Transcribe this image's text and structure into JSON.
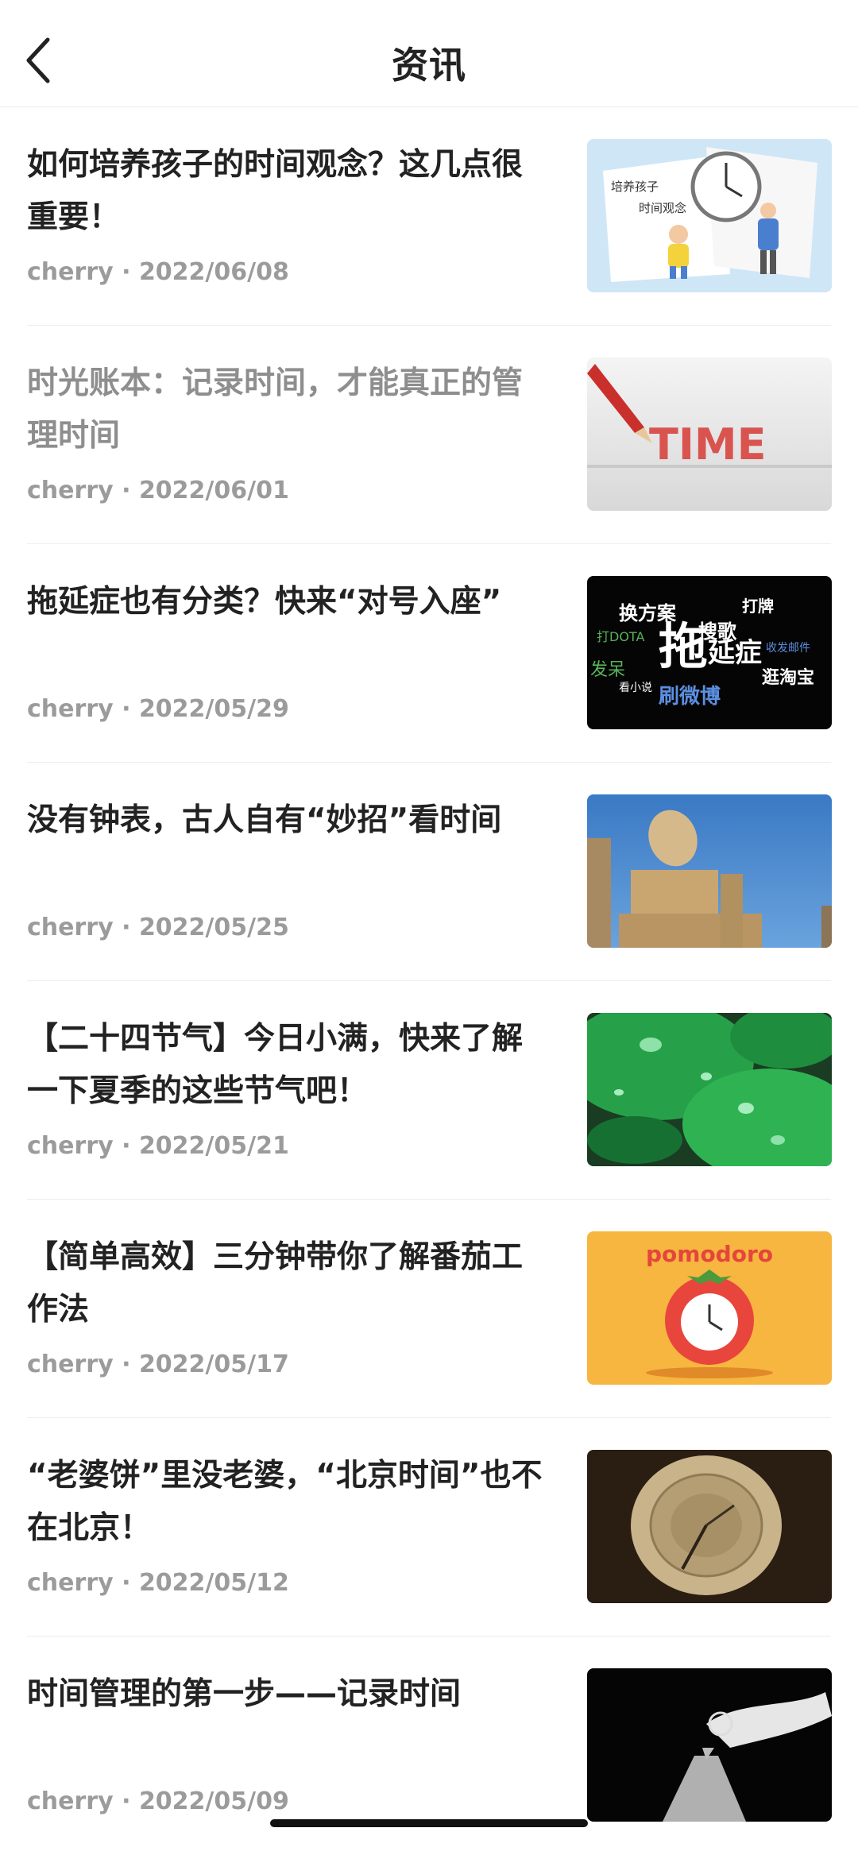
{
  "header": {
    "title": "资讯"
  },
  "items": [
    {
      "title": "如何培养孩子的时间观念？这几点很重要！",
      "author": "cherry",
      "date": "2022/06/08",
      "read": false,
      "thumb": {
        "caption_1": "培养孩子",
        "caption_2": "时间观念"
      }
    },
    {
      "title": "时光账本：记录时间，才能真正的管理时间",
      "author": "cherry",
      "date": "2022/06/01",
      "read": true,
      "thumb": {
        "word": "TIME"
      }
    },
    {
      "title": "拖延症也有分类？快来“对号入座”",
      "author": "cherry",
      "date": "2022/05/29",
      "read": false,
      "thumb": {
        "main_1": "拖",
        "main_2": "延症",
        "words": [
          "换方案",
          "搜歌",
          "打DOTA",
          "发呆",
          "刷微博",
          "逛淘宝",
          "打牌",
          "看小说",
          "收发邮件"
        ]
      }
    },
    {
      "title": "没有钟表，古人自有“妙招”看时间",
      "author": "cherry",
      "date": "2022/05/25",
      "read": false
    },
    {
      "title": "【二十四节气】今日小满，快来了解一下夏季的这些节气吧！",
      "author": "cherry",
      "date": "2022/05/21",
      "read": false
    },
    {
      "title": "【简单高效】三分钟带你了解番茄工作法",
      "author": "cherry",
      "date": "2022/05/17",
      "read": false,
      "thumb": {
        "word": "pomodoro"
      }
    },
    {
      "title": "“老婆饼”里没老婆，“北京时间”也不在北京！",
      "author": "cherry",
      "date": "2022/05/12",
      "read": false
    },
    {
      "title": "时间管理的第一步——记录时间",
      "author": "cherry",
      "date": "2022/05/09",
      "read": false
    }
  ],
  "meta_separator": " · ",
  "icons": {
    "back": "chevron-left-icon"
  },
  "colors": {
    "title": "#222222",
    "read_title": "#8e8e8e",
    "meta": "#9b9b9b"
  }
}
